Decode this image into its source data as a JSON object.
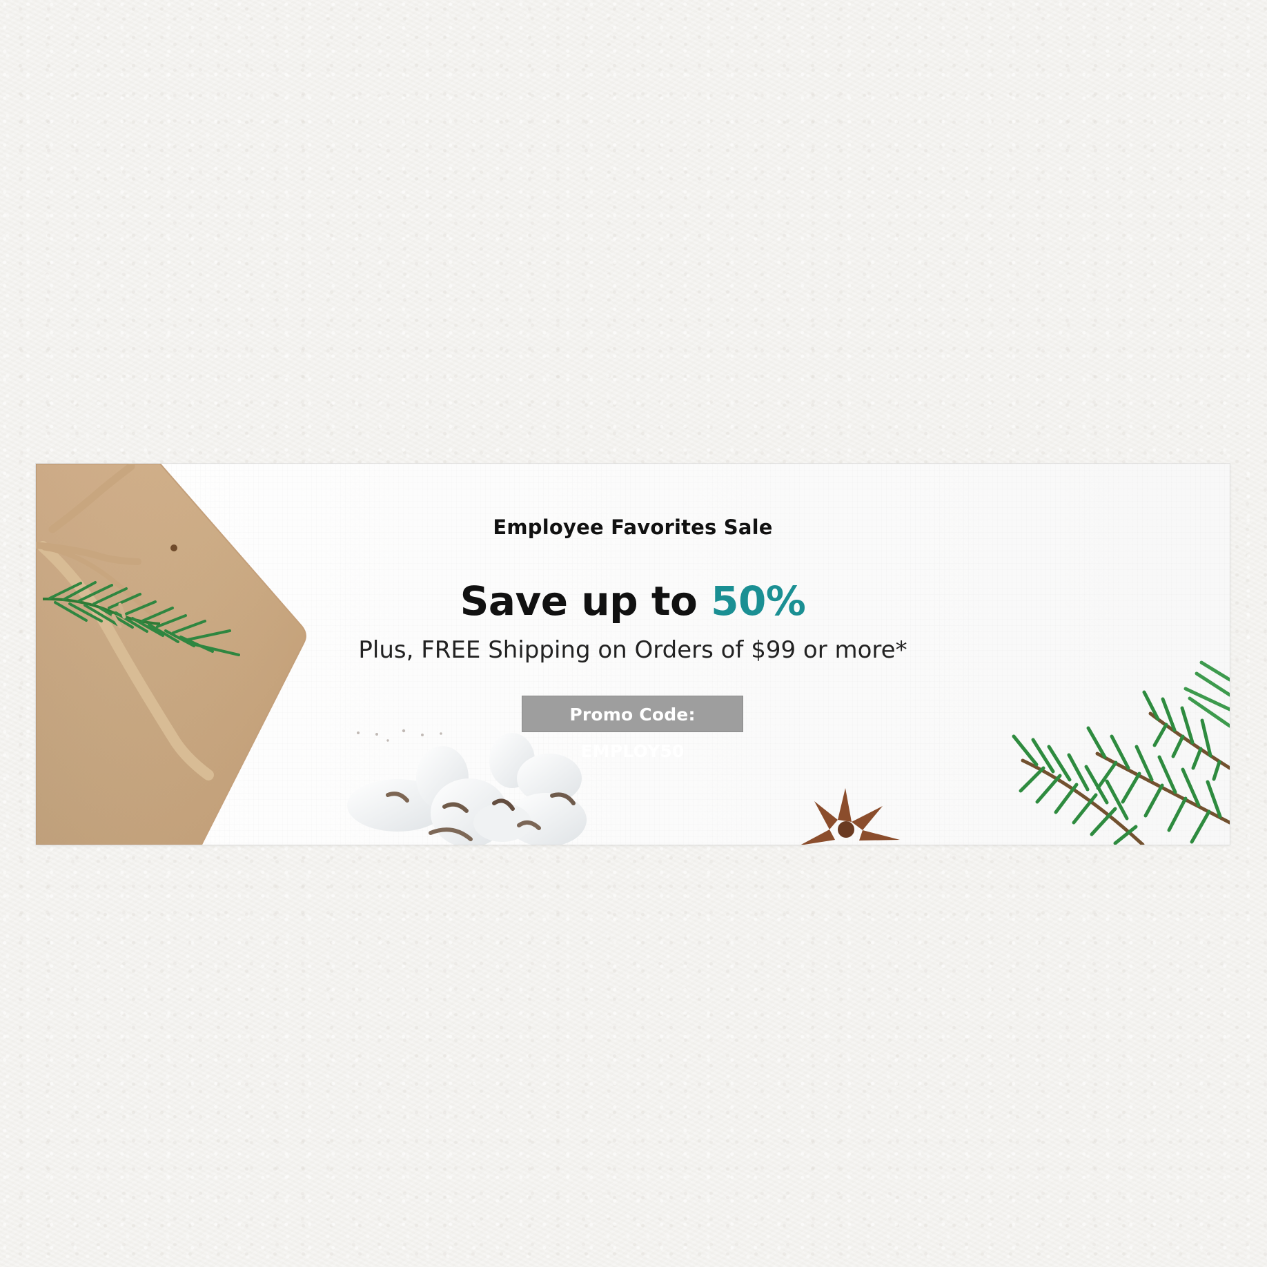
{
  "banner": {
    "eyebrow": "Employee Favorites Sale",
    "headline_main": "Save up to ",
    "headline_accent": "50%",
    "subline": "Plus, FREE Shipping on Orders of $99 or more*",
    "promo_label": "Promo Code: EMPLOY50"
  },
  "colors": {
    "accent": "#1a8f93",
    "promo_bg": "#9e9e9e"
  }
}
